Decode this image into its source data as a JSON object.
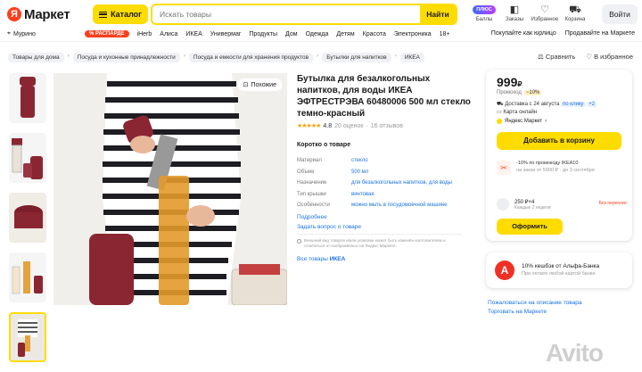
{
  "header": {
    "logo_ya": "Я",
    "logo_text": "Маркет",
    "catalog_label": "Каталог",
    "search_placeholder": "Искать товары",
    "search_button": "Найти",
    "icons": [
      {
        "name": "plus-icon",
        "label": "Баллы",
        "badge": "ПЛЮС"
      },
      {
        "name": "orders-icon",
        "label": "Заказы"
      },
      {
        "name": "favorites-icon",
        "label": "Избранное"
      },
      {
        "name": "cart-icon",
        "label": "Корзина"
      }
    ],
    "login_label": "Войти"
  },
  "nav": {
    "location": "Мурино",
    "sale_badge": "% РАСПАРДЕ",
    "items": [
      "iHerb",
      "Алиса",
      "ИКЕА",
      "Универмаг",
      "Продукты",
      "Дом",
      "Одежда",
      "Детям",
      "Красота",
      "Электроника",
      "18+"
    ],
    "right": [
      "Покупайте как юрлицо",
      "Продавайте на Маркете"
    ]
  },
  "breadcrumbs": [
    "Товары для дома",
    "Посуда и кухонные принадлежности",
    "Посуда и емкости для хранения продуктов",
    "Бутылки для напитков",
    "ИКЕА"
  ],
  "top_actions": {
    "compare": "Сравнить",
    "favorite": "В избранное"
  },
  "gallery": {
    "similar_label": "Похожие"
  },
  "product": {
    "title": "Бутылка для безалкогольных напитков, для воды ИКЕА ЭФТРЕСТРЭВА 60480006 500 мл стекло темно-красный",
    "rating": 4.8,
    "rating_text": "4.8",
    "reviews": "20 оценок",
    "questions": "16 отзывов",
    "about_label": "Коротко о товаре",
    "props": [
      {
        "k": "Материал",
        "v": "стекло"
      },
      {
        "k": "Объем",
        "v": "500 мл"
      },
      {
        "k": "Назначение",
        "v": "для безалкогольных напитков, для воды"
      },
      {
        "k": "Тип крышки",
        "v": "винтовая"
      },
      {
        "k": "Особенности",
        "v": "можно мыть в посудомоечной машине"
      }
    ],
    "more_link": "Подробнее",
    "ask_link": "Задать вопрос о товаре",
    "note": "Внешний вид товаров и/или упаковки может быть изменён изготовителем и отличаться от изображённых на Яндекс Маркете.",
    "all_goods_prefix": "Все товары",
    "all_goods_brand": "ИКЕА"
  },
  "offer": {
    "price": "999",
    "currency": "₽",
    "promo_label": "Промокод",
    "promo_pct": "−10%",
    "delivery": "Доставка с 24 августа",
    "delivery_pill": "по клику",
    "delivery_plus": "+2",
    "payment": "Карта онлайн",
    "seller": "Яндекс Маркет",
    "buy_button": "Добавить в корзину",
    "promo_text": "-10% по промокоду IKEA10",
    "promo_sub": "на заказ от 5000 ₽ · до 3 сентября",
    "split_text": "250 ₽×4",
    "split_sub": "Каждые 2 недели",
    "no_fee": "Без переплат",
    "order_button": "Оформить"
  },
  "alfa": {
    "logo": "А",
    "text": "10% кешбэк от Альфа-Банка",
    "sub": "При оплате любой картой банка"
  },
  "side_links": [
    "Пожаловаться на описание товара",
    "Торговать на Маркете"
  ],
  "watermark": "Avito",
  "colors": {
    "accent": "#ffdc00",
    "brand_red": "#fc3f1d",
    "link": "#1a73e8"
  }
}
